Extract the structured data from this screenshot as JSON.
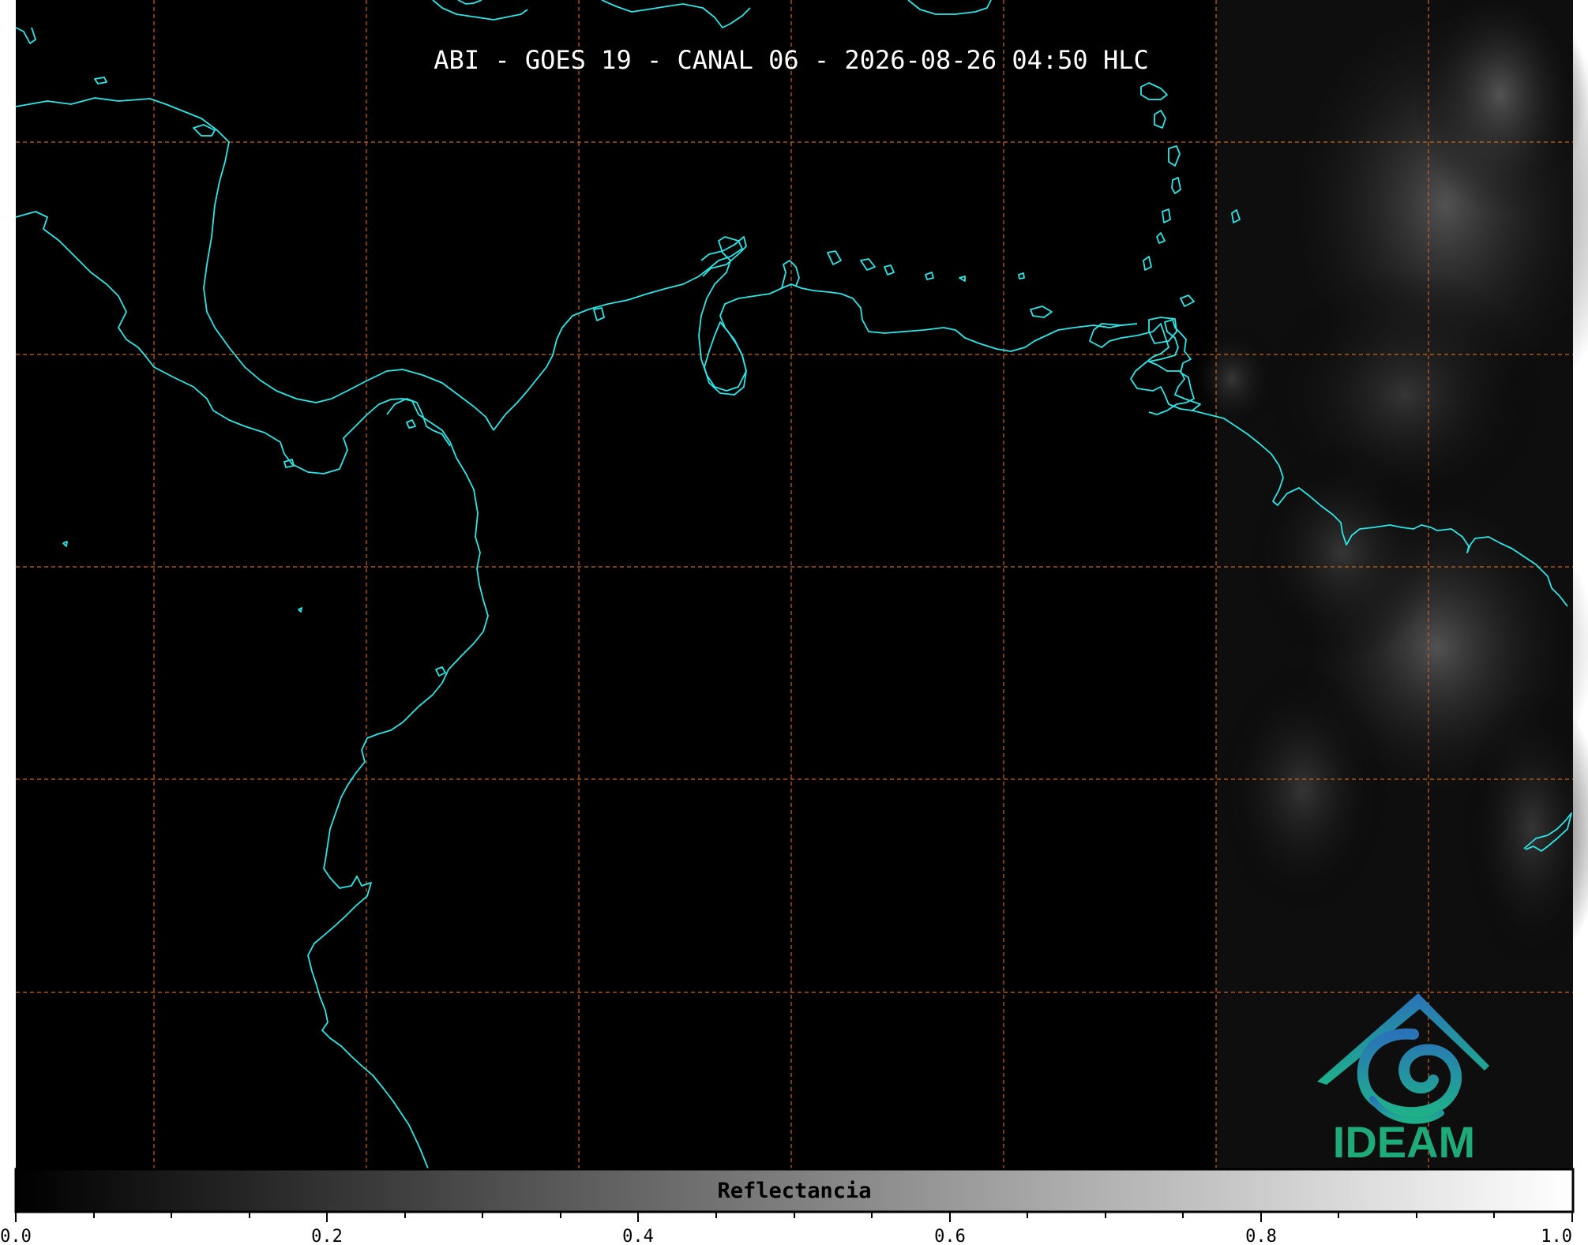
{
  "title": "ABI - GOES 19 - CANAL 06 - 2026-08-26 04:50 HLC",
  "colorbar": {
    "label": "Reflectancia",
    "ticks": [
      "0.0",
      "0.2",
      "0.4",
      "0.6",
      "0.8",
      "1.0"
    ]
  },
  "logo": {
    "text": "IDEAM"
  },
  "colors": {
    "background": "#000000",
    "coastline": "#2ee6e6",
    "gridline": "#c8661e",
    "logo_text": "#1faa7a",
    "logo_blue": "#2a73b8",
    "logo_teal": "#1f9f8f"
  }
}
